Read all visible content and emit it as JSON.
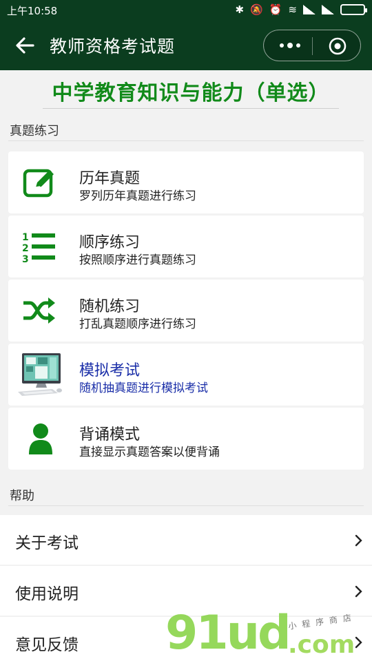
{
  "status": {
    "time": "上午10:58"
  },
  "nav": {
    "title": "教师资格考试题"
  },
  "banner": {
    "title": "中学教育知识与能力（单选）"
  },
  "sections": {
    "practice": "真题练习",
    "help": "帮助"
  },
  "cards": [
    {
      "title": "历年真题",
      "subtitle": "罗列历年真题进行练习",
      "icon": "edit-icon"
    },
    {
      "title": "顺序练习",
      "subtitle": "按照顺序进行真题练习",
      "icon": "ordered-list-icon"
    },
    {
      "title": "随机练习",
      "subtitle": "打乱真题顺序进行练习",
      "icon": "shuffle-icon"
    },
    {
      "title": "模拟考试",
      "subtitle": "随机抽真题进行模拟考试",
      "icon": "computer-icon"
    },
    {
      "title": "背诵模式",
      "subtitle": "直接显示真题答案以便背诵",
      "icon": "user-icon"
    }
  ],
  "help_items": [
    {
      "label": "关于考试"
    },
    {
      "label": "使用说明"
    },
    {
      "label": "意见反馈"
    }
  ],
  "watermark": {
    "brand": "91ud",
    "domain": ".com",
    "tagline": "小程序商店"
  },
  "colors": {
    "nav_bg": "#0b3d1f",
    "accent_green": "#118a1a",
    "highlight_blue": "#1a2ea8"
  }
}
